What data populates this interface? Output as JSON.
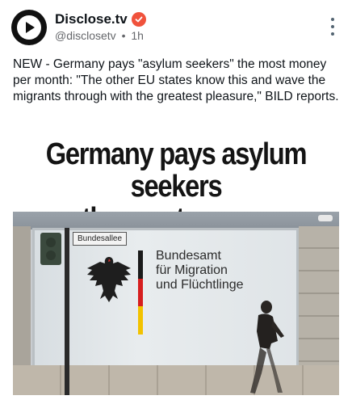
{
  "post": {
    "author_name": "Disclose.tv",
    "handle": "@disclosetv",
    "separator": "•",
    "time": "1h",
    "text": "NEW - Germany pays \"asylum seekers\" the most money per month: \"The other EU states know this and wave the migrants through with the greatest pleasure,\" BILD reports."
  },
  "card": {
    "headline_line1": "Germany pays asylum seekers",
    "headline_line2": "the most money",
    "image": {
      "street_sign": "Bundesallee",
      "agency_line1": "Bundesamt",
      "agency_line2": "für Migration",
      "agency_line3": "und Flüchtlinge"
    }
  },
  "colors": {
    "verified_badge": "#f0523c",
    "text_primary": "#0f1419",
    "text_secondary": "#65676b"
  },
  "icons": {
    "avatar": "disclose-tv-logo",
    "badge": "verified-check",
    "menu": "more-vertical"
  }
}
